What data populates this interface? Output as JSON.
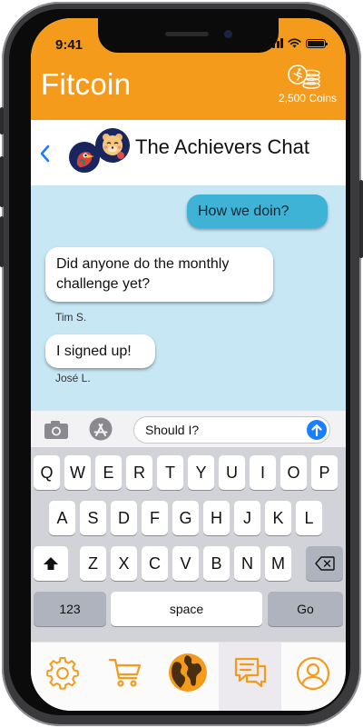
{
  "status_bar": {
    "time": "9:41",
    "signal_icon": "signal-bars",
    "wifi_icon": "wifi",
    "battery_icon": "battery",
    "battery_level": 1.0
  },
  "header": {
    "app_title": "Fitcoin",
    "coins_icon": "coins-running-icon",
    "coins_label": "2,500 Coins",
    "bg_color": "#f59b1c"
  },
  "chat_header": {
    "back_icon": "chevron-left-icon",
    "title": "The Achievers Chat",
    "avatars": [
      "bird-avatar",
      "bear-avatar"
    ]
  },
  "messages": [
    {
      "direction": "outgoing",
      "text": "How we doin?"
    },
    {
      "direction": "incoming",
      "text": "Did anyone do the monthly challenge yet?",
      "sender": "Tim S."
    },
    {
      "direction": "incoming",
      "text": "I signed up!",
      "sender": "José L."
    }
  ],
  "input_bar": {
    "camera_icon": "camera-icon",
    "appstore_icon": "app-store-icon",
    "value": "Should I?",
    "send_icon": "arrow-up-icon"
  },
  "keyboard": {
    "row1": [
      "Q",
      "W",
      "E",
      "R",
      "T",
      "Y",
      "U",
      "I",
      "O",
      "P"
    ],
    "row2": [
      "A",
      "S",
      "D",
      "F",
      "G",
      "H",
      "J",
      "K",
      "L"
    ],
    "row3": [
      "Z",
      "X",
      "C",
      "V",
      "B",
      "N",
      "M"
    ],
    "shift_icon": "shift-icon",
    "delete_icon": "delete-icon",
    "numbers_label": "123",
    "space_label": "space",
    "go_label": "Go"
  },
  "tabbar": {
    "items": [
      {
        "icon": "gear-icon",
        "name": "settings"
      },
      {
        "icon": "cart-icon",
        "name": "shop"
      },
      {
        "icon": "globe-icon",
        "name": "world"
      },
      {
        "icon": "chat-icon",
        "name": "chat",
        "active": true
      },
      {
        "icon": "user-icon",
        "name": "profile"
      }
    ],
    "accent_color": "#f59b1c"
  }
}
